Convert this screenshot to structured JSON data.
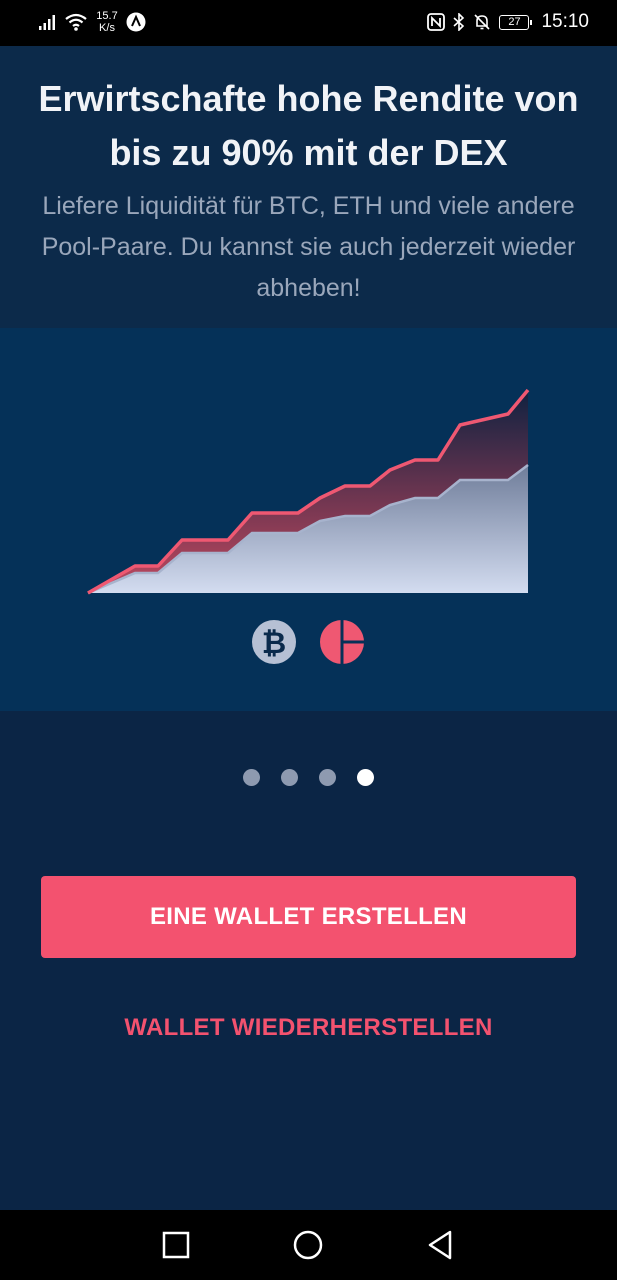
{
  "status_bar": {
    "speed_value": "15.7",
    "speed_unit": "K/s",
    "battery": "27",
    "time": "15:10",
    "icons": [
      "signal-icon",
      "wifi-icon",
      "app-notification-icon",
      "nfc-icon",
      "bluetooth-icon",
      "mute-bell-icon",
      "battery-icon"
    ]
  },
  "onboarding": {
    "title": "Erwirtschafte hohe Rendite von bis zu 90% mit der DEX",
    "subtitle": "Liefere Liquidität für BTC, ETH und viele andere Pool-Paare. Du kannst sie auch jederzeit wieder abheben!",
    "illustration_icons": [
      "bitcoin-icon",
      "pool-token-icon"
    ],
    "pager": {
      "total": 4,
      "active_index": 3
    }
  },
  "actions": {
    "create_wallet": "EINE WALLET ERSTELLEN",
    "restore_wallet": "WALLET WIEDERHERSTELLEN"
  },
  "nav_bar": {
    "icons": [
      "recents-square-icon",
      "home-circle-icon",
      "back-triangle-icon"
    ]
  },
  "colors": {
    "background": "#0b2545",
    "header": "#0c2a4a",
    "illustration": "#053158",
    "accent": "#f3526f",
    "dot_inactive": "#8e9ab0",
    "dot_active": "#ffffff"
  }
}
